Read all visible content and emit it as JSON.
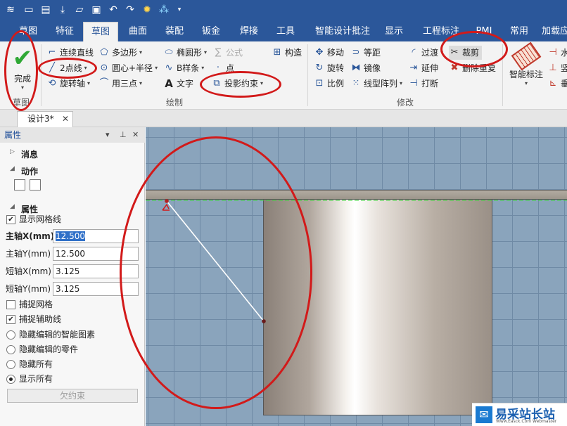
{
  "title_bar": {
    "quick_access": [
      "stack-icon",
      "new-icon",
      "open-icon",
      "export-icon",
      "folder-icon",
      "save-icon",
      "undo-icon",
      "redo-icon",
      "gear-icon",
      "sparkle-icon",
      "dropdown-icon"
    ]
  },
  "tabs": [
    {
      "label": "草图",
      "key": "t0"
    },
    {
      "label": "特征",
      "key": "t1"
    },
    {
      "label": "草图",
      "key": "t2",
      "active": true
    },
    {
      "label": "曲面",
      "key": "t3"
    },
    {
      "label": "装配",
      "key": "t4"
    },
    {
      "label": "钣金",
      "key": "t5"
    },
    {
      "label": "焊接",
      "key": "t6"
    },
    {
      "label": "工具",
      "key": "t7"
    },
    {
      "label": "智能设计批注",
      "key": "t8"
    },
    {
      "label": "显示",
      "key": "t9"
    },
    {
      "label": "工程标注",
      "key": "t10"
    },
    {
      "label": "PMI",
      "key": "t11"
    },
    {
      "label": "常用",
      "key": "t12"
    },
    {
      "label": "加载应",
      "key": "t13"
    }
  ],
  "ribbon": {
    "done": {
      "label": "完成",
      "group": "草图"
    },
    "draw": {
      "group": "绘制",
      "polyline": "连续直线",
      "two_point_line": "2点线",
      "rotate_axis": "旋转轴",
      "polygon": "多边形",
      "center_radius": "圆心+半径",
      "three_point": "用三点",
      "ellipse": "椭圆形",
      "bspline": "B样条",
      "text": "文字",
      "formula": "公式",
      "point": "点",
      "construct": "构造",
      "project_constraint": "投影约束"
    },
    "modify": {
      "group": "修改",
      "move": "移动",
      "rotate": "旋转",
      "scale": "比例",
      "equidistant": "等距",
      "mirror": "镜像",
      "linear_array": "线型阵列",
      "fillet": "过渡",
      "extend": "延伸",
      "break": "打断",
      "trim": "裁剪",
      "delete_repeat": "删除重复"
    },
    "dimension": {
      "smart_dim": "智能标注",
      "horizontal": "水",
      "vertical": "竖",
      "perpendicular": "垂"
    }
  },
  "document": {
    "tab_label": "设计3*"
  },
  "panel": {
    "title": "属性",
    "messages": "消息",
    "actions": "动作",
    "properties": "属性",
    "show_grid": {
      "label": "显示网格线",
      "checked": true
    },
    "major_x": {
      "label": "主轴X(mm)",
      "value": "12.500"
    },
    "major_y": {
      "label": "主轴Y(mm)",
      "value": "12.500"
    },
    "minor_x": {
      "label": "短轴X(mm)",
      "value": "3.125"
    },
    "minor_y": {
      "label": "短轴Y(mm)",
      "value": "3.125"
    },
    "snap_grid": {
      "label": "捕捉网格",
      "checked": false
    },
    "snap_helper": {
      "label": "捕捉辅助线",
      "checked": true
    },
    "radio_options": [
      {
        "label": "隐藏编辑的智能图素",
        "selected": false
      },
      {
        "label": "隐藏编辑的零件",
        "selected": false
      },
      {
        "label": "隐藏所有",
        "selected": false
      },
      {
        "label": "显示所有",
        "selected": true
      }
    ],
    "under_constrained": "欠约束"
  },
  "watermark": {
    "main": "易采站长站",
    "sub": "Www.Easck.Com  Webmaster"
  },
  "colors": {
    "brand": "#2b579a",
    "annotation": "#d21a1a",
    "check": "#2fa835"
  }
}
